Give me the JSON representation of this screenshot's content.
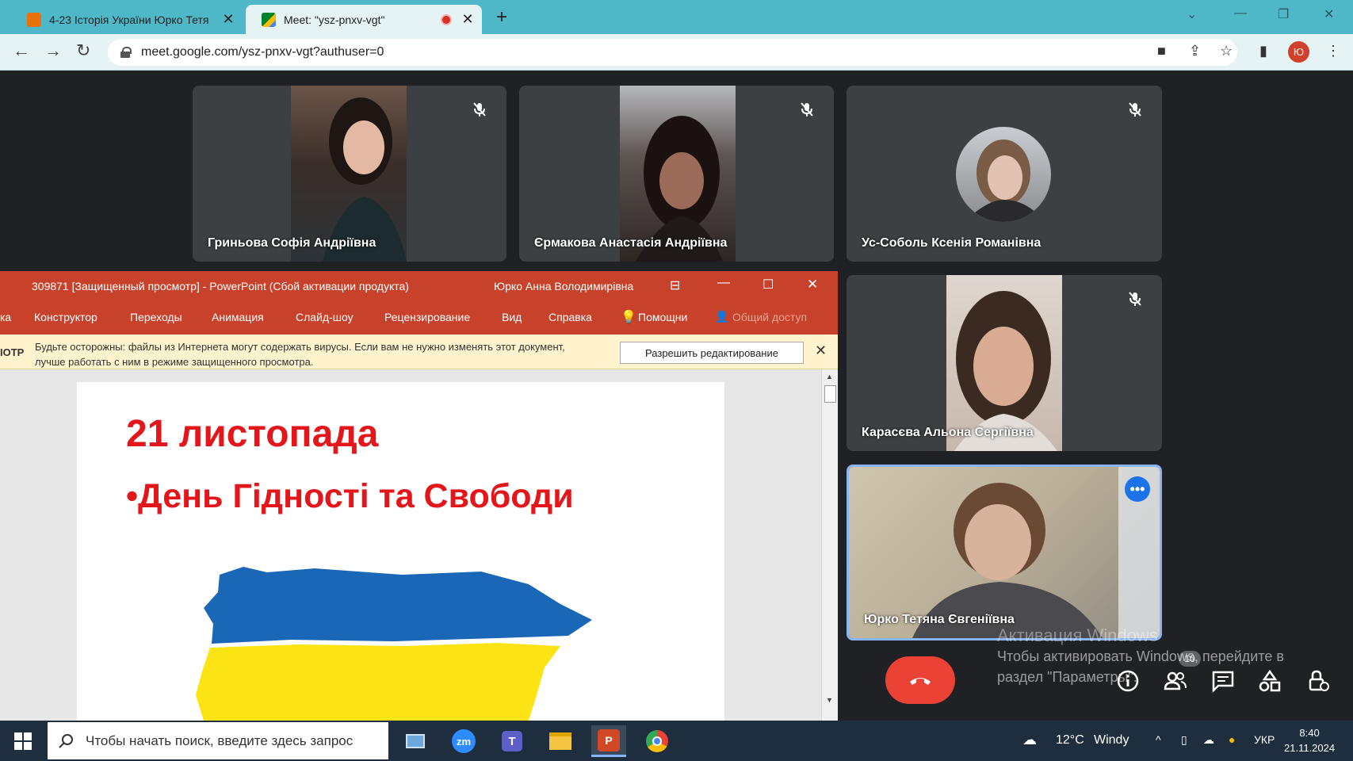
{
  "browser": {
    "tabs": [
      {
        "title": "4-23 Історія України Юрко Тетя",
        "favicon_color": "#e8710a",
        "active": false
      },
      {
        "title": "Meet: \"ysz-pnxv-vgt\"",
        "favicon_color": "#00832d",
        "active": true,
        "recording": true
      }
    ],
    "url": "meet.google.com/ysz-pnxv-vgt?authuser=0",
    "profile_initial": "Ю"
  },
  "meet": {
    "participants": [
      {
        "name": "Гриньова Софія Андріївна",
        "muted": true
      },
      {
        "name": "Єрмакова Анастасія Андріївна",
        "muted": true
      },
      {
        "name": "Ус-Соболь Ксенія Романівна",
        "muted": true
      },
      {
        "name": "Карасєва Альона Сергіївна",
        "muted": true
      },
      {
        "name": "Юрко Тетяна Євгеніївна",
        "muted": false,
        "speaking": true
      }
    ],
    "people_count": "10",
    "accent_color": "#1a73e8",
    "leave_color": "#ea4335"
  },
  "ppt": {
    "title": "309871 [Защищенный просмотр]  -  PowerPoint (Сбой активации продукта)",
    "user": "Юрко Анна Володимирівна",
    "ribbon": [
      "ка",
      "Конструктор",
      "Переходы",
      "Анимация",
      "Слайд-шоу",
      "Рецензирование",
      "Вид",
      "Справка",
      "Помощни",
      "Общий доступ"
    ],
    "warning_prefix": "ІОТР",
    "warning_text": "Будьте осторожны: файлы из Интернета могут содержать вирусы. Если вам не нужно изменять этот документ, лучше работать с ним в режиме защищенного просмотра.",
    "enable_button": "Разрешить редактирование",
    "slide": {
      "heading": "21 листопада",
      "bullet": "•День Гідності та Свободи"
    }
  },
  "windows_activation": {
    "title": "Активация Windows",
    "line1": "Чтобы активировать Windows, перейдите в",
    "line2": "раздел \"Параметры\"."
  },
  "taskbar": {
    "search_placeholder": "Чтобы начать поиск, введите здесь запрос",
    "temperature": "12°C",
    "weather": "Windy",
    "language": "УКР",
    "time": "8:40",
    "date": "21.11.2024"
  }
}
